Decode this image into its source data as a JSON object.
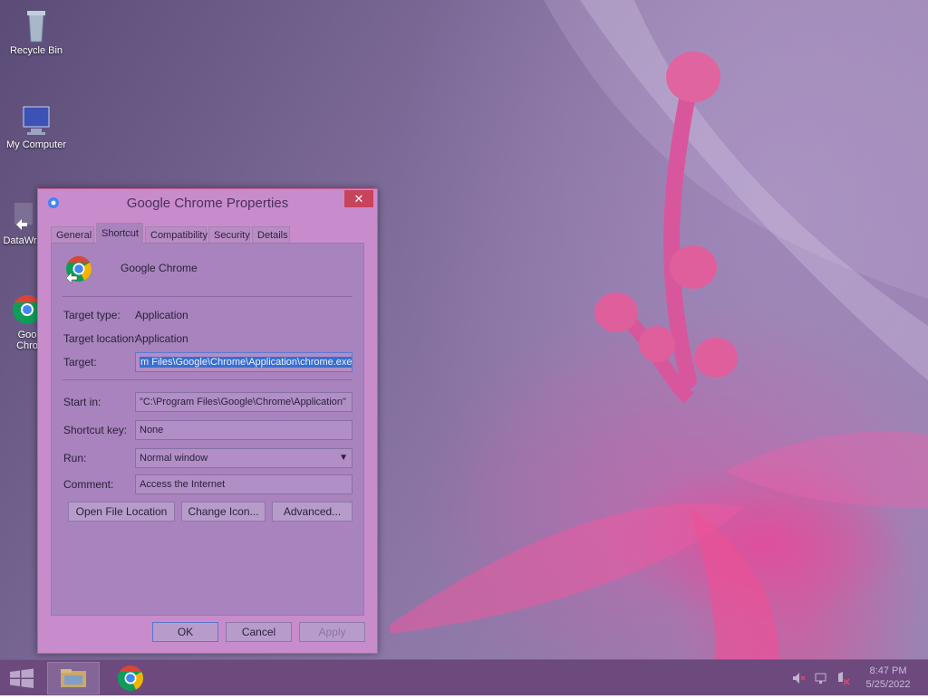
{
  "desktop": {
    "icons": [
      {
        "label": "Recycle Bin",
        "icon": "recycle-bin-icon"
      },
      {
        "label": "My Computer",
        "icon": "computer-icon"
      },
      {
        "label": "DataWr",
        "icon": "shortcut-icon"
      },
      {
        "label": "Goo",
        "label2": "Chro",
        "icon": "chrome-icon"
      }
    ]
  },
  "dialog": {
    "title": "Google Chrome Properties",
    "close_label": "✕",
    "tabs": [
      "General",
      "Shortcut",
      "Compatibility",
      "Security",
      "Details"
    ],
    "active_tab": "Shortcut",
    "app_name": "Google Chrome",
    "fields": {
      "target_type_label": "Target type:",
      "target_type_value": "Application",
      "target_location_label": "Target location:",
      "target_location_value": "Application",
      "target_label": "Target:",
      "target_value": "m Files\\Google\\Chrome\\Application\\chrome.exe\"",
      "start_in_label": "Start in:",
      "start_in_value": "\"C:\\Program Files\\Google\\Chrome\\Application\"",
      "shortcut_key_label": "Shortcut key:",
      "shortcut_key_value": "None",
      "run_label": "Run:",
      "run_value": "Normal window",
      "comment_label": "Comment:",
      "comment_value": "Access the Internet"
    },
    "buttons": {
      "open_file_location": "Open File Location",
      "change_icon": "Change Icon...",
      "advanced": "Advanced...",
      "ok": "OK",
      "cancel": "Cancel",
      "apply": "Apply"
    }
  },
  "taskbar": {
    "clock_time": "8:47 PM",
    "clock_date": "5/25/2022",
    "tray": [
      "volume-muted-icon",
      "network-icon",
      "action-center-icon"
    ]
  },
  "colors": {
    "accent_selection": "#3a6fd0",
    "close_button": "#c8435c",
    "chrome_red": "#db4437",
    "chrome_yellow": "#f4b400",
    "chrome_green": "#0f9d58",
    "chrome_blue": "#4285f4"
  }
}
